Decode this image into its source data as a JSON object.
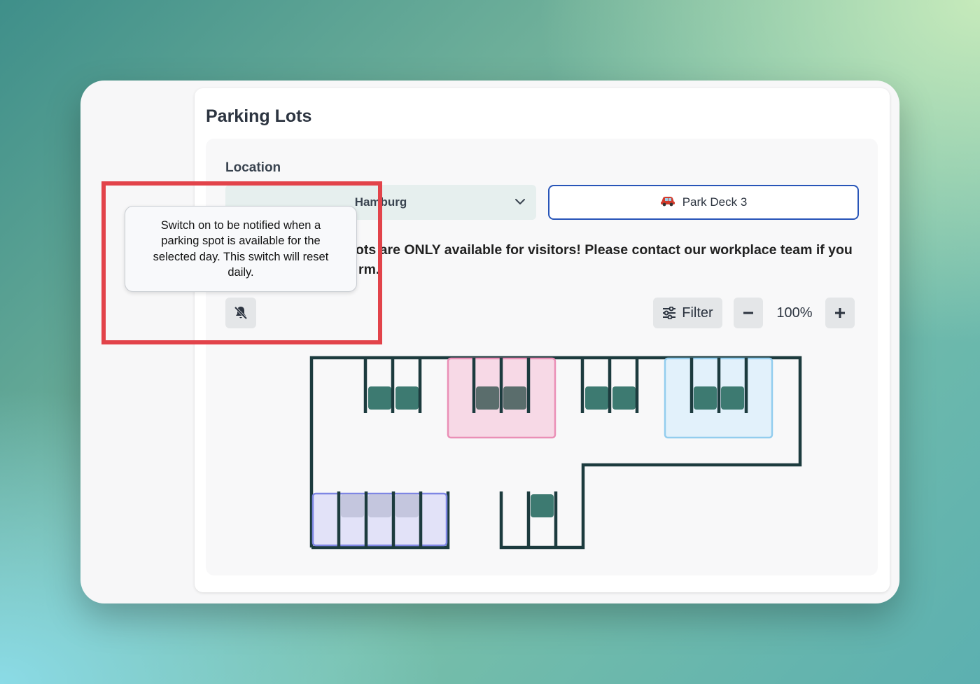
{
  "page": {
    "title": "Parking Lots"
  },
  "location": {
    "label": "Location",
    "selected": "Hamburg",
    "deck_button": "Park Deck 3"
  },
  "notice": {
    "visible_text": "ots are ONLY available for visitors! Please contact our workplace team if you",
    "visible_text_line2": "rm."
  },
  "tooltip": {
    "text": "Switch on to be notified when a parking spot is available for the selected day. This switch will reset daily."
  },
  "toolbar": {
    "filter_label": "Filter",
    "zoom_level": "100%"
  },
  "icons": {
    "notify": "bell-off-icon",
    "filter": "sliders-icon",
    "zoom_out": "minus-icon",
    "zoom_in": "plus-icon",
    "car": "car-icon",
    "dropdown": "chevron-down-icon"
  },
  "map": {
    "zones": [
      {
        "name": "pink",
        "color": "#f7d9e6",
        "border": "#ea8fb6"
      },
      {
        "name": "blue",
        "color": "#e2f1fb",
        "border": "#93cdee"
      },
      {
        "name": "purple",
        "color": "#e2e2f8",
        "border": "#7e86e4"
      }
    ],
    "spot_color": "#3d7a71",
    "wall_color": "#1c3b3e"
  },
  "colors": {
    "highlight": "#e2434a",
    "deck_border": "#2855b8"
  }
}
